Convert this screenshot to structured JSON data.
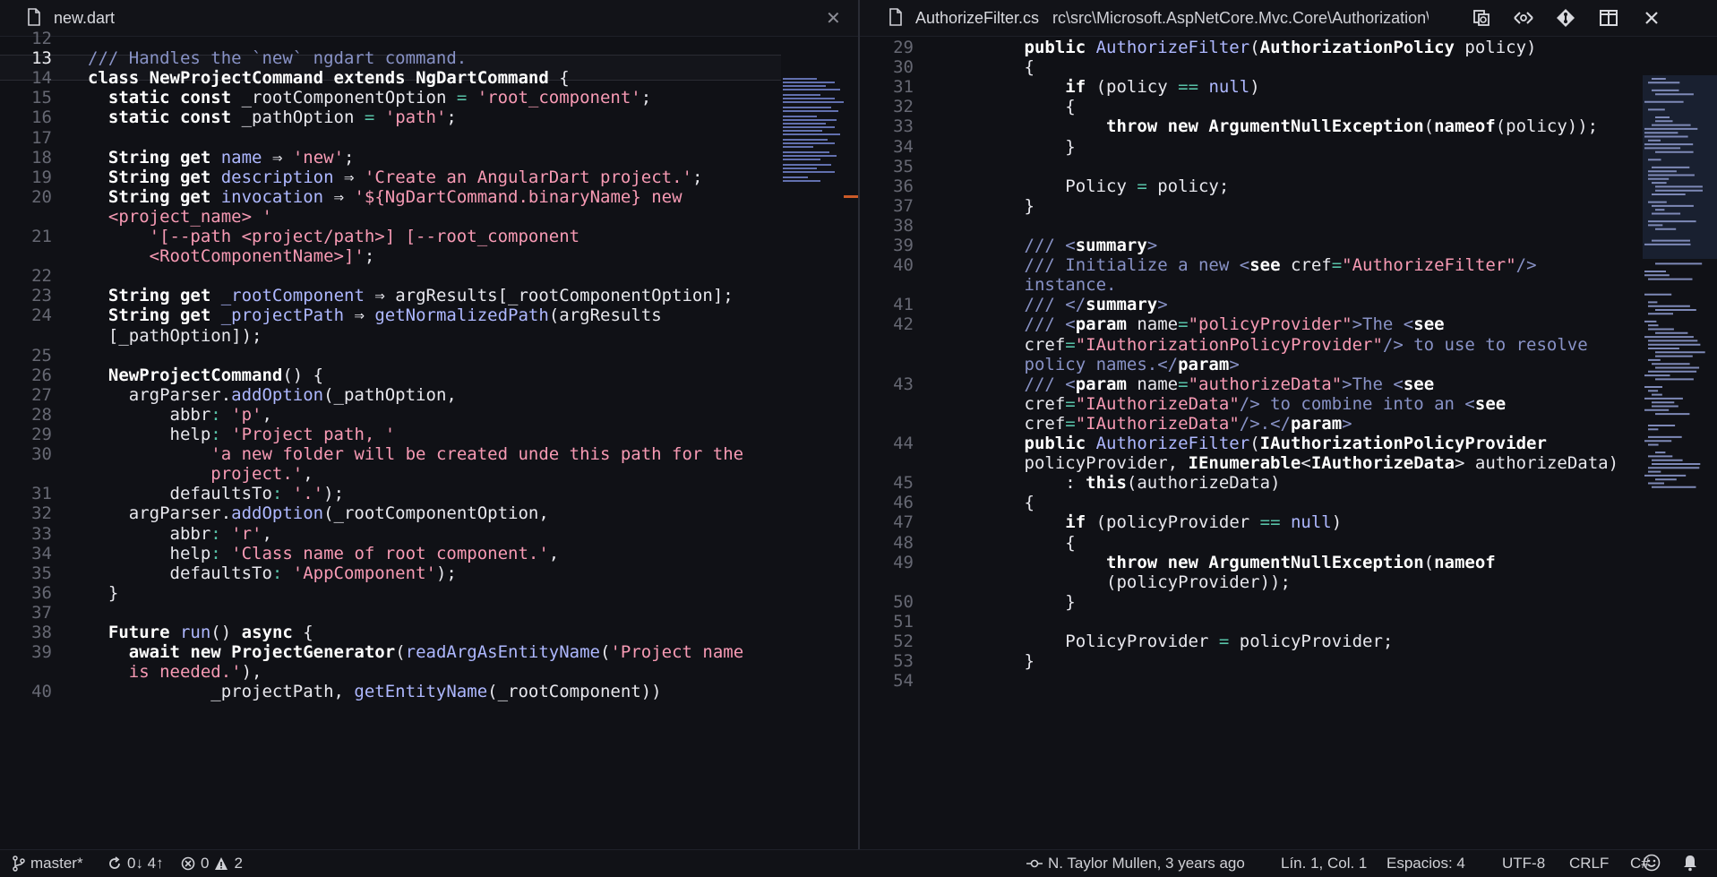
{
  "left_tab": {
    "title": "new.dart",
    "close_icon": "close-icon"
  },
  "right_tab": {
    "title": "AuthorizeFilter.cs",
    "breadcrumb": "rc\\src\\Microsoft.AspNetCore.Mvc.Core\\Authorization\\Autho",
    "actions": [
      "copy-path-icon",
      "diff-icon",
      "git-compare-icon",
      "split-editor-icon",
      "close-icon"
    ]
  },
  "left_editor": {
    "current_line": "13",
    "lines": [
      {
        "n": "12",
        "s": []
      },
      {
        "n": "13",
        "s": [
          [
            "cm",
            "/// Handles the `new` ngdart command."
          ]
        ]
      },
      {
        "n": "14",
        "s": [
          [
            "kw",
            "class "
          ],
          [
            "ty",
            "NewProjectCommand "
          ],
          [
            "kw",
            "extends "
          ],
          [
            "ty",
            "NgDartCommand"
          ],
          [
            "id",
            " {"
          ]
        ]
      },
      {
        "n": "15",
        "s": [
          [
            "id",
            "  "
          ],
          [
            "kw",
            "static const "
          ],
          [
            "id",
            "_rootComponentOption "
          ],
          [
            "op",
            "= "
          ],
          [
            "str",
            "'root_component'"
          ],
          [
            "id",
            ";"
          ]
        ]
      },
      {
        "n": "16",
        "s": [
          [
            "id",
            "  "
          ],
          [
            "kw",
            "static const "
          ],
          [
            "id",
            "_pathOption "
          ],
          [
            "op",
            "= "
          ],
          [
            "str",
            "'path'"
          ],
          [
            "id",
            ";"
          ]
        ]
      },
      {
        "n": "17",
        "s": []
      },
      {
        "n": "18",
        "s": [
          [
            "id",
            "  "
          ],
          [
            "ty",
            "String "
          ],
          [
            "kw",
            "get "
          ],
          [
            "fn",
            "name "
          ],
          [
            "id",
            "⇒ "
          ],
          [
            "str",
            "'new'"
          ],
          [
            "id",
            ";"
          ]
        ]
      },
      {
        "n": "19",
        "s": [
          [
            "id",
            "  "
          ],
          [
            "ty",
            "String "
          ],
          [
            "kw",
            "get "
          ],
          [
            "fn",
            "description "
          ],
          [
            "id",
            "⇒ "
          ],
          [
            "str",
            "'Create an AngularDart project.'"
          ],
          [
            "id",
            ";"
          ]
        ]
      },
      {
        "n": "20",
        "s": [
          [
            "id",
            "  "
          ],
          [
            "ty",
            "String "
          ],
          [
            "kw",
            "get "
          ],
          [
            "fn",
            "invocation "
          ],
          [
            "id",
            "⇒ "
          ],
          [
            "str",
            "'${NgDartCommand.binaryName} new"
          ]
        ]
      },
      {
        "n": "",
        "s": [
          [
            "id",
            "  "
          ],
          [
            "str",
            "<project_name> '"
          ]
        ]
      },
      {
        "n": "21",
        "s": [
          [
            "id",
            "      "
          ],
          [
            "str",
            "'[--path <project/path>] [--root_component"
          ]
        ]
      },
      {
        "n": "",
        "s": [
          [
            "id",
            "      "
          ],
          [
            "str",
            "<RootComponentName>]'"
          ],
          [
            "id",
            ";"
          ]
        ]
      },
      {
        "n": "22",
        "s": []
      },
      {
        "n": "23",
        "s": [
          [
            "id",
            "  "
          ],
          [
            "ty",
            "String "
          ],
          [
            "kw",
            "get "
          ],
          [
            "fn",
            "_rootComponent "
          ],
          [
            "id",
            "⇒ argResults[_rootComponentOption];"
          ]
        ]
      },
      {
        "n": "24",
        "s": [
          [
            "id",
            "  "
          ],
          [
            "ty",
            "String "
          ],
          [
            "kw",
            "get "
          ],
          [
            "fn",
            "_projectPath "
          ],
          [
            "id",
            "⇒ "
          ],
          [
            "fn",
            "getNormalizedPath"
          ],
          [
            "id",
            "(argResults"
          ]
        ]
      },
      {
        "n": "",
        "s": [
          [
            "id",
            "  [_pathOption]);"
          ]
        ]
      },
      {
        "n": "25",
        "s": []
      },
      {
        "n": "26",
        "s": [
          [
            "id",
            "  "
          ],
          [
            "ty",
            "NewProjectCommand"
          ],
          [
            "id",
            "() {"
          ]
        ]
      },
      {
        "n": "27",
        "s": [
          [
            "id",
            "    argParser."
          ],
          [
            "fn",
            "addOption"
          ],
          [
            "id",
            "(_pathOption,"
          ]
        ]
      },
      {
        "n": "28",
        "s": [
          [
            "id",
            "        abbr"
          ],
          [
            "op",
            ": "
          ],
          [
            "str",
            "'p'"
          ],
          [
            "id",
            ","
          ]
        ]
      },
      {
        "n": "29",
        "s": [
          [
            "id",
            "        help"
          ],
          [
            "op",
            ": "
          ],
          [
            "str",
            "'Project path, '"
          ]
        ]
      },
      {
        "n": "30",
        "s": [
          [
            "id",
            "            "
          ],
          [
            "str",
            "'a new folder will be created unde this path for the"
          ]
        ]
      },
      {
        "n": "",
        "s": [
          [
            "id",
            "            "
          ],
          [
            "str",
            "project.'"
          ],
          [
            "id",
            ","
          ]
        ]
      },
      {
        "n": "31",
        "s": [
          [
            "id",
            "        defaultsTo"
          ],
          [
            "op",
            ": "
          ],
          [
            "str",
            "'.'"
          ],
          [
            "id",
            ");"
          ]
        ]
      },
      {
        "n": "32",
        "s": [
          [
            "id",
            "    argParser."
          ],
          [
            "fn",
            "addOption"
          ],
          [
            "id",
            "(_rootComponentOption,"
          ]
        ]
      },
      {
        "n": "33",
        "s": [
          [
            "id",
            "        abbr"
          ],
          [
            "op",
            ": "
          ],
          [
            "str",
            "'r'"
          ],
          [
            "id",
            ","
          ]
        ]
      },
      {
        "n": "34",
        "s": [
          [
            "id",
            "        help"
          ],
          [
            "op",
            ": "
          ],
          [
            "str",
            "'Class name of root component.'"
          ],
          [
            "id",
            ","
          ]
        ]
      },
      {
        "n": "35",
        "s": [
          [
            "id",
            "        defaultsTo"
          ],
          [
            "op",
            ": "
          ],
          [
            "str",
            "'AppComponent'"
          ],
          [
            "id",
            ");"
          ]
        ]
      },
      {
        "n": "36",
        "s": [
          [
            "id",
            "  }"
          ]
        ]
      },
      {
        "n": "37",
        "s": []
      },
      {
        "n": "38",
        "s": [
          [
            "id",
            "  "
          ],
          [
            "ty",
            "Future "
          ],
          [
            "fn",
            "run"
          ],
          [
            "id",
            "() "
          ],
          [
            "kw",
            "async "
          ],
          [
            "id",
            "{"
          ]
        ]
      },
      {
        "n": "39",
        "s": [
          [
            "id",
            "    "
          ],
          [
            "kw",
            "await new "
          ],
          [
            "ty",
            "ProjectGenerator"
          ],
          [
            "id",
            "("
          ],
          [
            "fn",
            "readArgAsEntityName"
          ],
          [
            "id",
            "("
          ],
          [
            "str",
            "'Project name"
          ]
        ]
      },
      {
        "n": "",
        "s": [
          [
            "id",
            "    "
          ],
          [
            "str",
            "is needed.'"
          ],
          [
            "id",
            "),"
          ]
        ]
      },
      {
        "n": "40",
        "s": [
          [
            "id",
            "            _projectPath, "
          ],
          [
            "fn",
            "getEntityName"
          ],
          [
            "id",
            "(_rootComponent))"
          ]
        ]
      }
    ]
  },
  "right_editor": {
    "lines": [
      {
        "n": "29",
        "s": [
          [
            "id",
            "        "
          ],
          [
            "kw",
            "public "
          ],
          [
            "fn",
            "AuthorizeFilter"
          ],
          [
            "id",
            "("
          ],
          [
            "ty",
            "AuthorizationPolicy "
          ],
          [
            "id",
            "policy)"
          ]
        ]
      },
      {
        "n": "30",
        "s": [
          [
            "id",
            "        {"
          ]
        ]
      },
      {
        "n": "31",
        "s": [
          [
            "id",
            "            "
          ],
          [
            "kw",
            "if "
          ],
          [
            "id",
            "(policy "
          ],
          [
            "op",
            "== "
          ],
          [
            "fn",
            "null"
          ],
          [
            "id",
            ")"
          ]
        ]
      },
      {
        "n": "32",
        "s": [
          [
            "id",
            "            {"
          ]
        ]
      },
      {
        "n": "33",
        "s": [
          [
            "id",
            "                "
          ],
          [
            "kw",
            "throw new "
          ],
          [
            "ty",
            "ArgumentNullException"
          ],
          [
            "id",
            "("
          ],
          [
            "kw",
            "nameof"
          ],
          [
            "id",
            "(policy));"
          ]
        ]
      },
      {
        "n": "34",
        "s": [
          [
            "id",
            "            }"
          ]
        ]
      },
      {
        "n": "35",
        "s": []
      },
      {
        "n": "36",
        "s": [
          [
            "id",
            "            Policy "
          ],
          [
            "op",
            "= "
          ],
          [
            "id",
            "policy;"
          ]
        ]
      },
      {
        "n": "37",
        "s": [
          [
            "id",
            "        }"
          ]
        ]
      },
      {
        "n": "38",
        "s": []
      },
      {
        "n": "39",
        "s": [
          [
            "id",
            "        "
          ],
          [
            "cm",
            "/// <"
          ],
          [
            "kw",
            "summary"
          ],
          [
            "cm",
            ">"
          ]
        ]
      },
      {
        "n": "40",
        "s": [
          [
            "id",
            "        "
          ],
          [
            "cm",
            "/// Initialize a new <"
          ],
          [
            "kw",
            "see "
          ],
          [
            "id",
            "cref"
          ],
          [
            "op",
            "="
          ],
          [
            "str",
            "\"AuthorizeFilter\""
          ],
          [
            "cm",
            "/>"
          ]
        ]
      },
      {
        "n": "",
        "s": [
          [
            "id",
            "        "
          ],
          [
            "cm",
            "instance."
          ]
        ]
      },
      {
        "n": "41",
        "s": [
          [
            "id",
            "        "
          ],
          [
            "cm",
            "/// </"
          ],
          [
            "kw",
            "summary"
          ],
          [
            "cm",
            ">"
          ]
        ]
      },
      {
        "n": "42",
        "s": [
          [
            "id",
            "        "
          ],
          [
            "cm",
            "/// <"
          ],
          [
            "kw",
            "param "
          ],
          [
            "id",
            "name"
          ],
          [
            "op",
            "="
          ],
          [
            "str",
            "\"policyProvider\""
          ],
          [
            "cm",
            ">The <"
          ],
          [
            "kw",
            "see"
          ]
        ]
      },
      {
        "n": "",
        "s": [
          [
            "id",
            "        cref"
          ],
          [
            "op",
            "="
          ],
          [
            "str",
            "\"IAuthorizationPolicyProvider\""
          ],
          [
            "cm",
            "/> to use to resolve"
          ]
        ]
      },
      {
        "n": "",
        "s": [
          [
            "id",
            "        "
          ],
          [
            "cm",
            "policy names.</"
          ],
          [
            "kw",
            "param"
          ],
          [
            "cm",
            ">"
          ]
        ]
      },
      {
        "n": "43",
        "s": [
          [
            "id",
            "        "
          ],
          [
            "cm",
            "/// <"
          ],
          [
            "kw",
            "param "
          ],
          [
            "id",
            "name"
          ],
          [
            "op",
            "="
          ],
          [
            "str",
            "\"authorizeData\""
          ],
          [
            "cm",
            ">The <"
          ],
          [
            "kw",
            "see"
          ]
        ]
      },
      {
        "n": "",
        "s": [
          [
            "id",
            "        cref"
          ],
          [
            "op",
            "="
          ],
          [
            "str",
            "\"IAuthorizeData\""
          ],
          [
            "cm",
            "/> to combine into an <"
          ],
          [
            "kw",
            "see"
          ]
        ]
      },
      {
        "n": "",
        "s": [
          [
            "id",
            "        cref"
          ],
          [
            "op",
            "="
          ],
          [
            "str",
            "\"IAuthorizeData\""
          ],
          [
            "cm",
            "/>.</"
          ],
          [
            "kw",
            "param"
          ],
          [
            "cm",
            ">"
          ]
        ]
      },
      {
        "n": "44",
        "s": [
          [
            "id",
            "        "
          ],
          [
            "kw",
            "public "
          ],
          [
            "fn",
            "AuthorizeFilter"
          ],
          [
            "id",
            "("
          ],
          [
            "ty",
            "IAuthorizationPolicyProvider"
          ]
        ]
      },
      {
        "n": "",
        "s": [
          [
            "id",
            "        policyProvider, "
          ],
          [
            "ty",
            "IEnumerable"
          ],
          [
            "id",
            "<"
          ],
          [
            "ty",
            "IAuthorizeData"
          ],
          [
            "id",
            "> authorizeData)"
          ]
        ]
      },
      {
        "n": "45",
        "s": [
          [
            "id",
            "            : "
          ],
          [
            "kw",
            "this"
          ],
          [
            "id",
            "(authorizeData)"
          ]
        ]
      },
      {
        "n": "46",
        "s": [
          [
            "id",
            "        {"
          ]
        ]
      },
      {
        "n": "47",
        "s": [
          [
            "id",
            "            "
          ],
          [
            "kw",
            "if "
          ],
          [
            "id",
            "(policyProvider "
          ],
          [
            "op",
            "== "
          ],
          [
            "fn",
            "null"
          ],
          [
            "id",
            ")"
          ]
        ]
      },
      {
        "n": "48",
        "s": [
          [
            "id",
            "            {"
          ]
        ]
      },
      {
        "n": "49",
        "s": [
          [
            "id",
            "                "
          ],
          [
            "kw",
            "throw new "
          ],
          [
            "ty",
            "ArgumentNullException"
          ],
          [
            "id",
            "("
          ],
          [
            "kw",
            "nameof"
          ]
        ]
      },
      {
        "n": "",
        "s": [
          [
            "id",
            "                (policyProvider));"
          ]
        ]
      },
      {
        "n": "50",
        "s": [
          [
            "id",
            "            }"
          ]
        ]
      },
      {
        "n": "51",
        "s": []
      },
      {
        "n": "52",
        "s": [
          [
            "id",
            "            PolicyProvider "
          ],
          [
            "op",
            "= "
          ],
          [
            "id",
            "policyProvider;"
          ]
        ]
      },
      {
        "n": "53",
        "s": [
          [
            "id",
            "        }"
          ]
        ]
      },
      {
        "n": "54",
        "s": []
      }
    ]
  },
  "statusbar": {
    "branch": "master*",
    "sync": "0↓ 4↑",
    "errors": "0",
    "warnings": "2",
    "blame": "N. Taylor Mullen, 3 years ago",
    "position": "Lín. 1, Col. 1",
    "indent": "Espacios: 4",
    "encoding": "UTF-8",
    "eol": "CRLF",
    "language": "C#",
    "colors": {
      "keyword": "#ffffff",
      "function": "#aeb8ff",
      "string": "#f79ab4",
      "comment": "#8892c6",
      "operator": "#58c2a8",
      "minimap_marker": "#e0622a"
    }
  }
}
